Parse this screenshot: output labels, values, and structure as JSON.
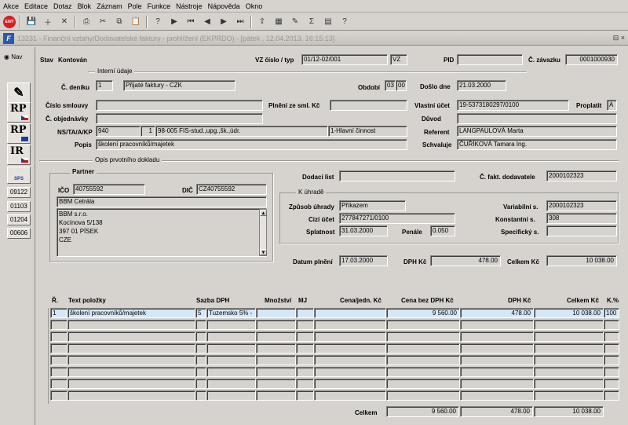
{
  "menu": [
    "Akce",
    "Editace",
    "Dotaz",
    "Blok",
    "Záznam",
    "Pole",
    "Funkce",
    "Nástroje",
    "Nápověda",
    "Okno"
  ],
  "toolbar": {
    "exit_label": "EXIT",
    "icons": [
      "exit-icon",
      "save-icon",
      "insert-record-icon",
      "delete-record-icon",
      "print-icon",
      "cut-icon",
      "copy-icon",
      "paste-icon",
      "query-icon",
      "run-query-icon",
      "first-record-icon",
      "prev-record-icon",
      "next-record-icon",
      "last-record-icon",
      "export-icon",
      "calendar-icon",
      "edit-icon",
      "sum-icon",
      "excel-icon",
      "help-icon"
    ]
  },
  "window": {
    "title": "13231 - Finanční vztahy/Dodavatelské faktury - prohlížení (EKPRDO) - [pátek , 12.04.2013, 16:15:13]",
    "controls": "⊟ ×"
  },
  "nav": {
    "label": "Nav",
    "buttons": [
      "RP",
      "RP",
      "IR"
    ],
    "sps_label": "SPS",
    "codes": [
      "09122",
      "01103",
      "01204",
      "00606"
    ]
  },
  "header": {
    "stav_label": "Stav",
    "stav_value": "Kontován",
    "vz_label": "VZ číslo / typ",
    "vz_value": "01/12-02/001",
    "vz_type": "VZ",
    "pid_label": "PID",
    "pid_value": "",
    "zavazek_label": "Č. závazku",
    "zavazek_value": "0001000930"
  },
  "interni": {
    "group_title": "Interní údaje",
    "denik_label": "Č. deníku",
    "denik_value": "1",
    "denik_text": "Přijaté faktury - CZK",
    "obdobi_label": "Období",
    "obdobi_a": "03",
    "obdobi_b": "00",
    "doslo_label": "Došlo dne",
    "doslo_value": "21.03.2000",
    "smlouva_label": "Číslo smlouvy",
    "smlouva_value": "",
    "plneni_label": "Plnění ze sml. Kč",
    "plneni_value": "",
    "ucet_label": "Vlastní účet",
    "ucet_value": "19-5373180297/0100",
    "proplatit_label": "Proplatit",
    "proplatit_value": "A",
    "objednavka_label": "Č. objednávky",
    "objednavka_value": "",
    "duvod_label": "Důvod",
    "duvod_value": "",
    "nsta_label": "NS/TA/A/KP",
    "nsta_a": "940",
    "nsta_b": "1",
    "nsta_c": "98-005 FIS-stud.,upg.,šk.,údr.",
    "nsta_d": "1-Hlavní činnost",
    "referent_label": "Referent",
    "referent_value": "LANGPAULOVÁ Marta",
    "popis_label": "Popis",
    "popis_value": "školení pracovníků/majetek",
    "schvaluje_label": "Schvaluje",
    "schvaluje_value": "ČUŘÍKOVÁ Tamara Ing."
  },
  "opis": {
    "group_title": "Opis prvotního dokladu",
    "partner_title": "Partner",
    "ico_label": "IČO",
    "ico_value": "40755592",
    "dic_label": "DIČ",
    "dic_value": "CZ40755592",
    "partner_name": "BBM Cetrála",
    "address_lines": [
      "BBM s.r.o.",
      "Kocínova 5/138",
      "397 01 PÍSEK",
      "CZE"
    ],
    "dodaci_label": "Dodací list",
    "dodaci_value": "",
    "fakt_label": "Č. fakt. dodavatele",
    "fakt_value": "2000102323",
    "uhrade_title": "K úhradě",
    "zpusob_label": "Způsob úhrady",
    "zpusob_value": "Příkazem",
    "variabilni_label": "Variabilní s.",
    "variabilni_value": "2000102323",
    "cizi_label": "Cizí účet",
    "cizi_value": "277847271/0100",
    "konstantni_label": "Konstantní s.",
    "konstantni_value": "308",
    "splatnost_label": "Splatnost",
    "splatnost_value": "31.03.2000",
    "penale_label": "Penále",
    "penale_value": "0.050",
    "specificky_label": "Specifický s.",
    "specificky_value": "",
    "datum_label": "Datum plnění",
    "datum_value": "17.03.2000",
    "dph_label": "DPH Kč",
    "dph_value": "478.00",
    "celkem_label": "Celkem Kč",
    "celkem_value": "10 038.00"
  },
  "grid": {
    "headers": [
      "Ř.",
      "Text položky",
      "Sazba DPH",
      "Množství",
      "MJ",
      "Cena/jedn. Kč",
      "Cena bez DPH Kč",
      "DPH Kč",
      "Celkem Kč",
      "K.%"
    ],
    "rows": [
      [
        "1",
        "školení pracovníků/majetek",
        "5",
        "Tuzemsko 5% -",
        "",
        "",
        "",
        "9 560.00",
        "478.00",
        "10 038.00",
        "100"
      ]
    ],
    "total_label": "Celkem",
    "total_bez": "9 560.00",
    "total_dph": "478.00",
    "total_celkem": "10 038.00"
  }
}
